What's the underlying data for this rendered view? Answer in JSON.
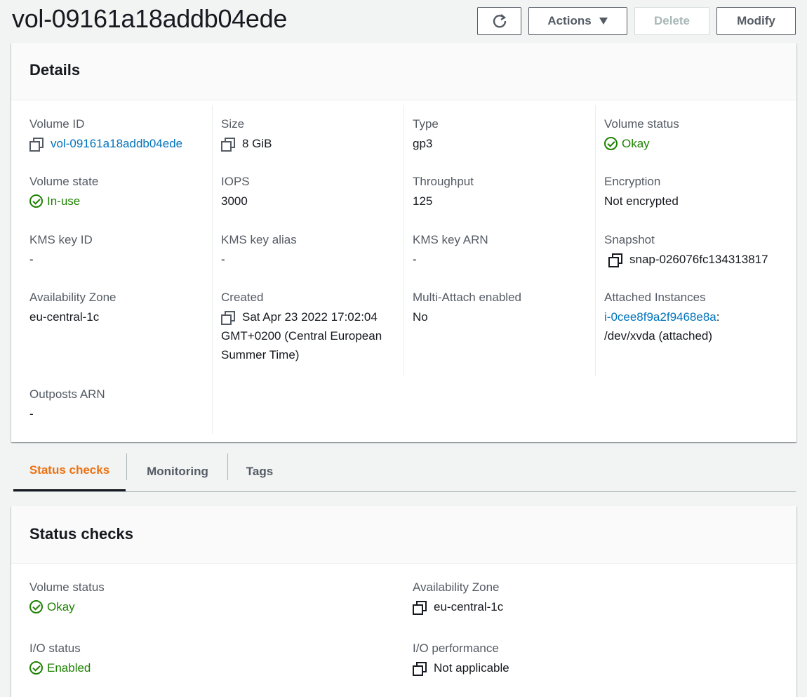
{
  "header": {
    "title": "vol-09161a18addb04ede",
    "actions_label": "Actions",
    "delete_label": "Delete",
    "modify_label": "Modify"
  },
  "details": {
    "heading": "Details",
    "volume_id": {
      "label": "Volume ID",
      "value": "vol-09161a18addb04ede"
    },
    "size": {
      "label": "Size",
      "value": "8 GiB"
    },
    "type": {
      "label": "Type",
      "value": "gp3"
    },
    "volume_status": {
      "label": "Volume status",
      "value": "Okay"
    },
    "volume_state": {
      "label": "Volume state",
      "value": "In-use"
    },
    "iops": {
      "label": "IOPS",
      "value": "3000"
    },
    "throughput": {
      "label": "Throughput",
      "value": "125"
    },
    "encryption": {
      "label": "Encryption",
      "value": "Not encrypted"
    },
    "kms_key_id": {
      "label": "KMS key ID",
      "value": "-"
    },
    "kms_key_alias": {
      "label": "KMS key alias",
      "value": "-"
    },
    "kms_key_arn": {
      "label": "KMS key ARN",
      "value": "-"
    },
    "snapshot": {
      "label": "Snapshot",
      "value": "snap-026076fc134313817"
    },
    "availability_zone": {
      "label": "Availability Zone",
      "value": "eu-central-1c"
    },
    "created": {
      "label": "Created",
      "line1": "Sat Apr 23 2022 17:02:04",
      "line2": "GMT+0200 (Central European",
      "line3": "Summer Time)"
    },
    "multi_attach": {
      "label": "Multi-Attach enabled",
      "value": "No"
    },
    "attached_instances": {
      "label": "Attached Instances",
      "instance": "i-0cee8f9a2f9468e8a",
      "colon": ":",
      "device": "/dev/xvda (attached)"
    },
    "outposts_arn": {
      "label": "Outposts ARN",
      "value": "-"
    }
  },
  "tabs": [
    {
      "label": "Status checks"
    },
    {
      "label": "Monitoring"
    },
    {
      "label": "Tags"
    }
  ],
  "status_checks": {
    "heading": "Status checks",
    "volume_status": {
      "label": "Volume status",
      "value": "Okay"
    },
    "availability_zone": {
      "label": "Availability Zone",
      "value": "eu-central-1c"
    },
    "io_status": {
      "label": "I/O status",
      "value": "Enabled"
    },
    "io_performance": {
      "label": "I/O performance",
      "value": "Not applicable"
    }
  },
  "colors": {
    "link": "#0073bb",
    "success": "#1d8102",
    "active_tab": "#ec7211"
  }
}
